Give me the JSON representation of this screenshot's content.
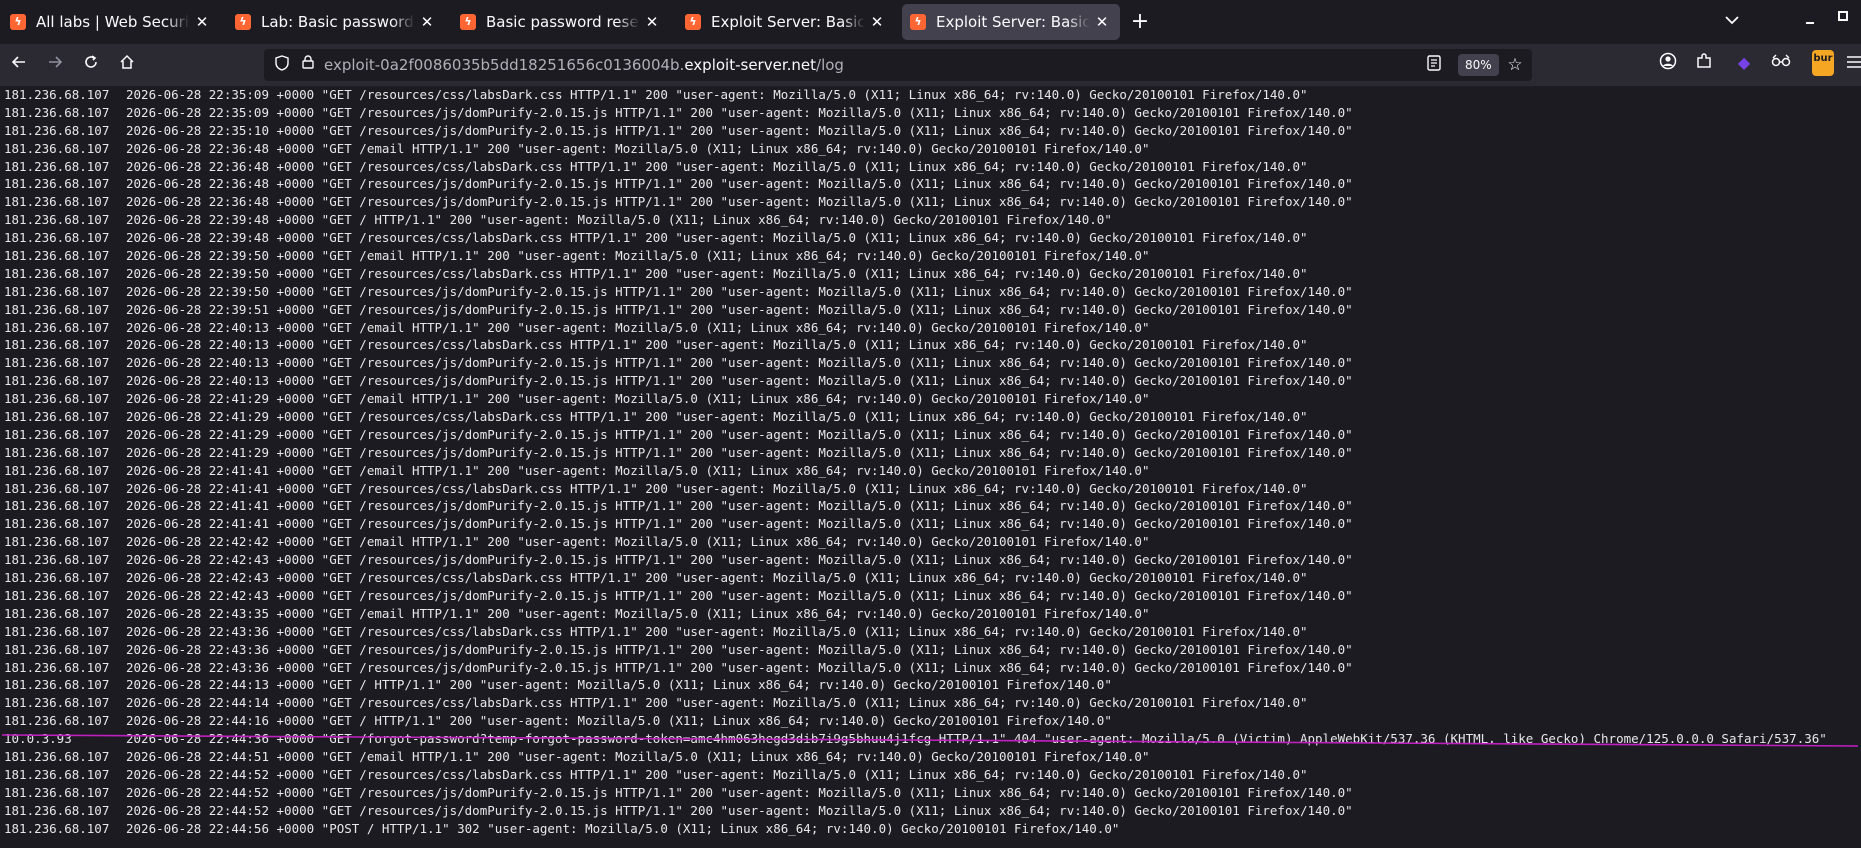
{
  "tabs": [
    {
      "title": "All labs | Web Security Academy",
      "active": false
    },
    {
      "title": "Lab: Basic password reset poisoning",
      "active": false
    },
    {
      "title": "Basic password reset poisoning",
      "active": false
    },
    {
      "title": "Exploit Server: Basic password reset poisoning",
      "active": false
    },
    {
      "title": "Exploit Server: Basic password reset poisoning",
      "active": true
    }
  ],
  "tab_close_glyph": "✕",
  "new_tab_glyph": "+",
  "url": {
    "prefix": "exploit-0a2f0086035b5dd18251656c0136004b.",
    "domain": "exploit-server.net",
    "path": "/log"
  },
  "zoom": "80%",
  "burp_label": "bur",
  "colors": {
    "background": "#1c1b22",
    "toolbar": "#2b2a33",
    "active_tab": "#42414d",
    "favicon": "#ff6633",
    "annotation": "#c020c0"
  },
  "log": [
    {
      "ip": "181.236.68.107",
      "entry": "2026-06-28 22:35:09 +0000 \"GET /resources/css/labsDark.css HTTP/1.1\" 200 \"user-agent: Mozilla/5.0 (X11; Linux x86_64; rv:140.0) Gecko/20100101 Firefox/140.0\""
    },
    {
      "ip": "181.236.68.107",
      "entry": "2026-06-28 22:35:09 +0000 \"GET /resources/js/domPurify-2.0.15.js HTTP/1.1\" 200 \"user-agent: Mozilla/5.0 (X11; Linux x86_64; rv:140.0) Gecko/20100101 Firefox/140.0\""
    },
    {
      "ip": "181.236.68.107",
      "entry": "2026-06-28 22:35:10 +0000 \"GET /resources/js/domPurify-2.0.15.js HTTP/1.1\" 200 \"user-agent: Mozilla/5.0 (X11; Linux x86_64; rv:140.0) Gecko/20100101 Firefox/140.0\""
    },
    {
      "ip": "181.236.68.107",
      "entry": "2026-06-28 22:36:48 +0000 \"GET /email HTTP/1.1\" 200 \"user-agent: Mozilla/5.0 (X11; Linux x86_64; rv:140.0) Gecko/20100101 Firefox/140.0\""
    },
    {
      "ip": "181.236.68.107",
      "entry": "2026-06-28 22:36:48 +0000 \"GET /resources/css/labsDark.css HTTP/1.1\" 200 \"user-agent: Mozilla/5.0 (X11; Linux x86_64; rv:140.0) Gecko/20100101 Firefox/140.0\""
    },
    {
      "ip": "181.236.68.107",
      "entry": "2026-06-28 22:36:48 +0000 \"GET /resources/js/domPurify-2.0.15.js HTTP/1.1\" 200 \"user-agent: Mozilla/5.0 (X11; Linux x86_64; rv:140.0) Gecko/20100101 Firefox/140.0\""
    },
    {
      "ip": "181.236.68.107",
      "entry": "2026-06-28 22:36:48 +0000 \"GET /resources/js/domPurify-2.0.15.js HTTP/1.1\" 200 \"user-agent: Mozilla/5.0 (X11; Linux x86_64; rv:140.0) Gecko/20100101 Firefox/140.0\""
    },
    {
      "ip": "181.236.68.107",
      "entry": "2026-06-28 22:39:48 +0000 \"GET / HTTP/1.1\" 200 \"user-agent: Mozilla/5.0 (X11; Linux x86_64; rv:140.0) Gecko/20100101 Firefox/140.0\""
    },
    {
      "ip": "181.236.68.107",
      "entry": "2026-06-28 22:39:48 +0000 \"GET /resources/css/labsDark.css HTTP/1.1\" 200 \"user-agent: Mozilla/5.0 (X11; Linux x86_64; rv:140.0) Gecko/20100101 Firefox/140.0\""
    },
    {
      "ip": "181.236.68.107",
      "entry": "2026-06-28 22:39:50 +0000 \"GET /email HTTP/1.1\" 200 \"user-agent: Mozilla/5.0 (X11; Linux x86_64; rv:140.0) Gecko/20100101 Firefox/140.0\""
    },
    {
      "ip": "181.236.68.107",
      "entry": "2026-06-28 22:39:50 +0000 \"GET /resources/css/labsDark.css HTTP/1.1\" 200 \"user-agent: Mozilla/5.0 (X11; Linux x86_64; rv:140.0) Gecko/20100101 Firefox/140.0\""
    },
    {
      "ip": "181.236.68.107",
      "entry": "2026-06-28 22:39:50 +0000 \"GET /resources/js/domPurify-2.0.15.js HTTP/1.1\" 200 \"user-agent: Mozilla/5.0 (X11; Linux x86_64; rv:140.0) Gecko/20100101 Firefox/140.0\""
    },
    {
      "ip": "181.236.68.107",
      "entry": "2026-06-28 22:39:51 +0000 \"GET /resources/js/domPurify-2.0.15.js HTTP/1.1\" 200 \"user-agent: Mozilla/5.0 (X11; Linux x86_64; rv:140.0) Gecko/20100101 Firefox/140.0\""
    },
    {
      "ip": "181.236.68.107",
      "entry": "2026-06-28 22:40:13 +0000 \"GET /email HTTP/1.1\" 200 \"user-agent: Mozilla/5.0 (X11; Linux x86_64; rv:140.0) Gecko/20100101 Firefox/140.0\""
    },
    {
      "ip": "181.236.68.107",
      "entry": "2026-06-28 22:40:13 +0000 \"GET /resources/css/labsDark.css HTTP/1.1\" 200 \"user-agent: Mozilla/5.0 (X11; Linux x86_64; rv:140.0) Gecko/20100101 Firefox/140.0\""
    },
    {
      "ip": "181.236.68.107",
      "entry": "2026-06-28 22:40:13 +0000 \"GET /resources/js/domPurify-2.0.15.js HTTP/1.1\" 200 \"user-agent: Mozilla/5.0 (X11; Linux x86_64; rv:140.0) Gecko/20100101 Firefox/140.0\""
    },
    {
      "ip": "181.236.68.107",
      "entry": "2026-06-28 22:40:13 +0000 \"GET /resources/js/domPurify-2.0.15.js HTTP/1.1\" 200 \"user-agent: Mozilla/5.0 (X11; Linux x86_64; rv:140.0) Gecko/20100101 Firefox/140.0\""
    },
    {
      "ip": "181.236.68.107",
      "entry": "2026-06-28 22:41:29 +0000 \"GET /email HTTP/1.1\" 200 \"user-agent: Mozilla/5.0 (X11; Linux x86_64; rv:140.0) Gecko/20100101 Firefox/140.0\""
    },
    {
      "ip": "181.236.68.107",
      "entry": "2026-06-28 22:41:29 +0000 \"GET /resources/css/labsDark.css HTTP/1.1\" 200 \"user-agent: Mozilla/5.0 (X11; Linux x86_64; rv:140.0) Gecko/20100101 Firefox/140.0\""
    },
    {
      "ip": "181.236.68.107",
      "entry": "2026-06-28 22:41:29 +0000 \"GET /resources/js/domPurify-2.0.15.js HTTP/1.1\" 200 \"user-agent: Mozilla/5.0 (X11; Linux x86_64; rv:140.0) Gecko/20100101 Firefox/140.0\""
    },
    {
      "ip": "181.236.68.107",
      "entry": "2026-06-28 22:41:29 +0000 \"GET /resources/js/domPurify-2.0.15.js HTTP/1.1\" 200 \"user-agent: Mozilla/5.0 (X11; Linux x86_64; rv:140.0) Gecko/20100101 Firefox/140.0\""
    },
    {
      "ip": "181.236.68.107",
      "entry": "2026-06-28 22:41:41 +0000 \"GET /email HTTP/1.1\" 200 \"user-agent: Mozilla/5.0 (X11; Linux x86_64; rv:140.0) Gecko/20100101 Firefox/140.0\""
    },
    {
      "ip": "181.236.68.107",
      "entry": "2026-06-28 22:41:41 +0000 \"GET /resources/css/labsDark.css HTTP/1.1\" 200 \"user-agent: Mozilla/5.0 (X11; Linux x86_64; rv:140.0) Gecko/20100101 Firefox/140.0\""
    },
    {
      "ip": "181.236.68.107",
      "entry": "2026-06-28 22:41:41 +0000 \"GET /resources/js/domPurify-2.0.15.js HTTP/1.1\" 200 \"user-agent: Mozilla/5.0 (X11; Linux x86_64; rv:140.0) Gecko/20100101 Firefox/140.0\""
    },
    {
      "ip": "181.236.68.107",
      "entry": "2026-06-28 22:41:41 +0000 \"GET /resources/js/domPurify-2.0.15.js HTTP/1.1\" 200 \"user-agent: Mozilla/5.0 (X11; Linux x86_64; rv:140.0) Gecko/20100101 Firefox/140.0\""
    },
    {
      "ip": "181.236.68.107",
      "entry": "2026-06-28 22:42:42 +0000 \"GET /email HTTP/1.1\" 200 \"user-agent: Mozilla/5.0 (X11; Linux x86_64; rv:140.0) Gecko/20100101 Firefox/140.0\""
    },
    {
      "ip": "181.236.68.107",
      "entry": "2026-06-28 22:42:43 +0000 \"GET /resources/js/domPurify-2.0.15.js HTTP/1.1\" 200 \"user-agent: Mozilla/5.0 (X11; Linux x86_64; rv:140.0) Gecko/20100101 Firefox/140.0\""
    },
    {
      "ip": "181.236.68.107",
      "entry": "2026-06-28 22:42:43 +0000 \"GET /resources/css/labsDark.css HTTP/1.1\" 200 \"user-agent: Mozilla/5.0 (X11; Linux x86_64; rv:140.0) Gecko/20100101 Firefox/140.0\""
    },
    {
      "ip": "181.236.68.107",
      "entry": "2026-06-28 22:42:43 +0000 \"GET /resources/js/domPurify-2.0.15.js HTTP/1.1\" 200 \"user-agent: Mozilla/5.0 (X11; Linux x86_64; rv:140.0) Gecko/20100101 Firefox/140.0\""
    },
    {
      "ip": "181.236.68.107",
      "entry": "2026-06-28 22:43:35 +0000 \"GET /email HTTP/1.1\" 200 \"user-agent: Mozilla/5.0 (X11; Linux x86_64; rv:140.0) Gecko/20100101 Firefox/140.0\""
    },
    {
      "ip": "181.236.68.107",
      "entry": "2026-06-28 22:43:36 +0000 \"GET /resources/css/labsDark.css HTTP/1.1\" 200 \"user-agent: Mozilla/5.0 (X11; Linux x86_64; rv:140.0) Gecko/20100101 Firefox/140.0\""
    },
    {
      "ip": "181.236.68.107",
      "entry": "2026-06-28 22:43:36 +0000 \"GET /resources/js/domPurify-2.0.15.js HTTP/1.1\" 200 \"user-agent: Mozilla/5.0 (X11; Linux x86_64; rv:140.0) Gecko/20100101 Firefox/140.0\""
    },
    {
      "ip": "181.236.68.107",
      "entry": "2026-06-28 22:43:36 +0000 \"GET /resources/js/domPurify-2.0.15.js HTTP/1.1\" 200 \"user-agent: Mozilla/5.0 (X11; Linux x86_64; rv:140.0) Gecko/20100101 Firefox/140.0\""
    },
    {
      "ip": "181.236.68.107",
      "entry": "2026-06-28 22:44:13 +0000 \"GET / HTTP/1.1\" 200 \"user-agent: Mozilla/5.0 (X11; Linux x86_64; rv:140.0) Gecko/20100101 Firefox/140.0\""
    },
    {
      "ip": "181.236.68.107",
      "entry": "2026-06-28 22:44:14 +0000 \"GET /resources/css/labsDark.css HTTP/1.1\" 200 \"user-agent: Mozilla/5.0 (X11; Linux x86_64; rv:140.0) Gecko/20100101 Firefox/140.0\""
    },
    {
      "ip": "181.236.68.107",
      "entry": "2026-06-28 22:44:16 +0000 \"GET / HTTP/1.1\" 200 \"user-agent: Mozilla/5.0 (X11; Linux x86_64; rv:140.0) Gecko/20100101 Firefox/140.0\""
    },
    {
      "ip": "10.0.3.93",
      "entry": "2026-06-28 22:44:36 +0000 \"GET /forgot-password?temp-forgot-password-token=amc4hm063hegd3dib7i9g5bhuu4j1fcg HTTP/1.1\" 404 \"user-agent: Mozilla/5.0 (Victim) AppleWebKit/537.36 (KHTML, like Gecko) Chrome/125.0.0.0 Safari/537.36\""
    },
    {
      "ip": "181.236.68.107",
      "entry": "2026-06-28 22:44:51 +0000 \"GET /email HTTP/1.1\" 200 \"user-agent: Mozilla/5.0 (X11; Linux x86_64; rv:140.0) Gecko/20100101 Firefox/140.0\""
    },
    {
      "ip": "181.236.68.107",
      "entry": "2026-06-28 22:44:52 +0000 \"GET /resources/css/labsDark.css HTTP/1.1\" 200 \"user-agent: Mozilla/5.0 (X11; Linux x86_64; rv:140.0) Gecko/20100101 Firefox/140.0\""
    },
    {
      "ip": "181.236.68.107",
      "entry": "2026-06-28 22:44:52 +0000 \"GET /resources/js/domPurify-2.0.15.js HTTP/1.1\" 200 \"user-agent: Mozilla/5.0 (X11; Linux x86_64; rv:140.0) Gecko/20100101 Firefox/140.0\""
    },
    {
      "ip": "181.236.68.107",
      "entry": "2026-06-28 22:44:52 +0000 \"GET /resources/js/domPurify-2.0.15.js HTTP/1.1\" 200 \"user-agent: Mozilla/5.0 (X11; Linux x86_64; rv:140.0) Gecko/20100101 Firefox/140.0\""
    },
    {
      "ip": "181.236.68.107",
      "entry": "2026-06-28 22:44:56 +0000 \"POST / HTTP/1.1\" 302 \"user-agent: Mozilla/5.0 (X11; Linux x86_64; rv:140.0) Gecko/20100101 Firefox/140.0\""
    }
  ]
}
